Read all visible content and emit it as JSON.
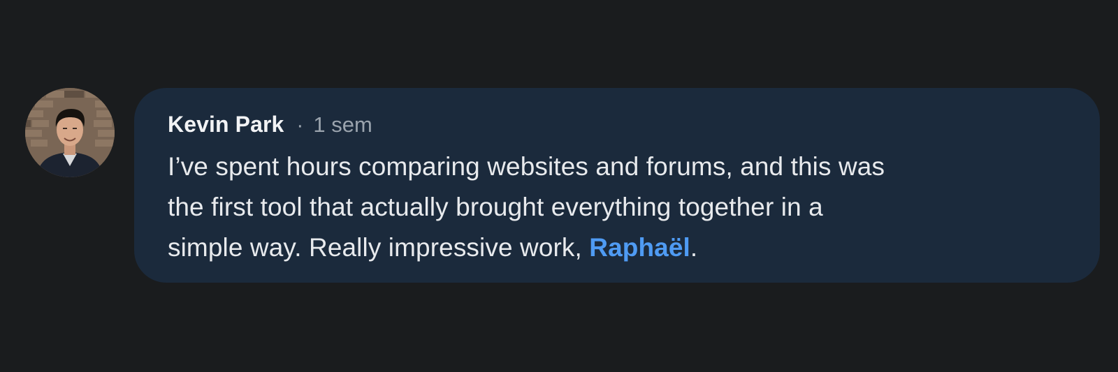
{
  "comment": {
    "author": "Kevin Park",
    "separator": "·",
    "timestamp": "1 sem",
    "lines": [
      "I’ve spent hours comparing websites and forums, and this was",
      "the first tool that actually brought everything together in a",
      "simple way. Really impressive work, "
    ],
    "mention": "Raphaël",
    "trailing": "."
  },
  "colors": {
    "background": "#1a1c1e",
    "bubble": "#1b2a3c",
    "mention": "#4f9bf3",
    "timestamp": "#9aa3ad"
  }
}
